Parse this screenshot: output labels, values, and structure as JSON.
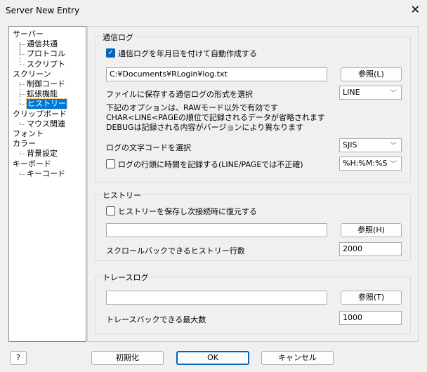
{
  "window": {
    "title": "Server New Entry",
    "close": "✕"
  },
  "tree": {
    "items": [
      {
        "label": "サーバー",
        "level": 0
      },
      {
        "label": "通信共通",
        "level": 1
      },
      {
        "label": "プロトコル",
        "level": 1
      },
      {
        "label": "スクリプト",
        "level": 1
      },
      {
        "label": "スクリーン",
        "level": 0
      },
      {
        "label": "制御コード",
        "level": 1
      },
      {
        "label": "拡張機能",
        "level": 1
      },
      {
        "label": "ヒストリー",
        "level": 1,
        "selected": true
      },
      {
        "label": "クリップボード",
        "level": 0
      },
      {
        "label": "マウス関連",
        "level": 1
      },
      {
        "label": "フォント",
        "level": 0
      },
      {
        "label": "カラー",
        "level": 0
      },
      {
        "label": "背景設定",
        "level": 1
      },
      {
        "label": "キーボード",
        "level": 0
      },
      {
        "label": "キーコード",
        "level": 1
      }
    ]
  },
  "log": {
    "group": "通信ログ",
    "auto_checkbox": "通信ログを年月日を付けて自動作成する",
    "auto_checked": true,
    "path": "C:¥Documents¥RLogin¥log.txt",
    "browse": "参照(L)",
    "format_label": "ファイルに保存する通信ログの形式を選択",
    "format_value": "LINE",
    "note1": "下記のオプションは、RAWモード以外で有効です",
    "note2": "CHAR<LINE<PAGEの順位で記録されるデータが省略されます",
    "note3": "DEBUGは記録される内容がバージョンにより異なります",
    "charset_label": "ログの文字コードを選択",
    "charset_value": "SJIS",
    "time_checkbox": "ログの行頭に時間を記録する(LINE/PAGEでは不正確)",
    "time_checked": false,
    "time_format": "%H:%M:%S"
  },
  "history": {
    "group": "ヒストリー",
    "save_checkbox": "ヒストリーを保存し次接続時に復元する",
    "save_checked": false,
    "path": "",
    "browse": "参照(H)",
    "lines_label": "スクロールバックできるヒストリー行数",
    "lines_value": "2000"
  },
  "trace": {
    "group": "トレースログ",
    "path": "",
    "browse": "参照(T)",
    "max_label": "トレースバックできる最大数",
    "max_value": "1000"
  },
  "footer": {
    "help": "?",
    "reset": "初期化",
    "ok": "OK",
    "cancel": "キャンセル"
  },
  "colors": {
    "accent": "#0078d7",
    "checkbox": "#0067c0"
  }
}
